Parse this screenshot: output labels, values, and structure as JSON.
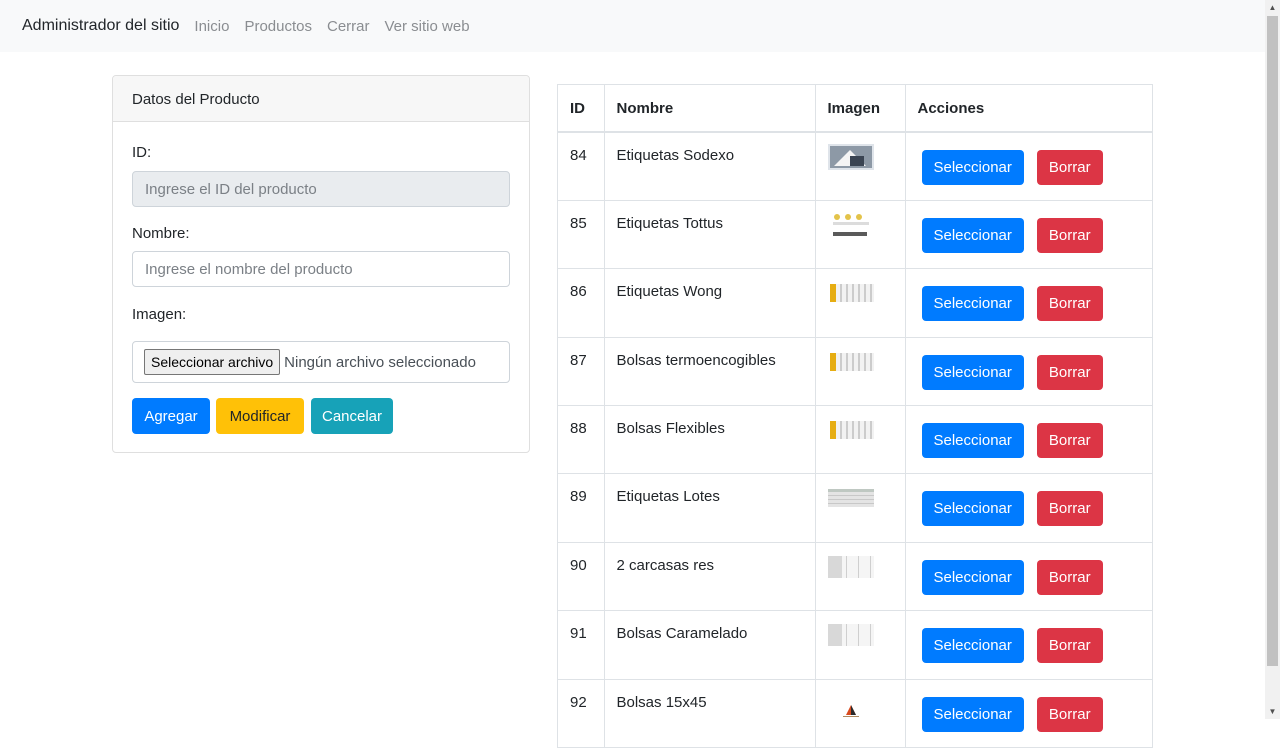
{
  "navbar": {
    "brand": "Administrador del sitio",
    "links": [
      "Inicio",
      "Productos",
      "Cerrar",
      "Ver sitio web"
    ]
  },
  "form": {
    "header": "Datos del Producto",
    "id_label": "ID:",
    "id_placeholder": "Ingrese el ID del producto",
    "name_label": "Nombre:",
    "name_placeholder": "Ingrese el nombre del producto",
    "image_label": "Imagen:",
    "file_button": "Seleccionar archivo",
    "file_status": "Ningún archivo seleccionado",
    "buttons": {
      "add": "Agregar",
      "modify": "Modificar",
      "cancel": "Cancelar"
    }
  },
  "table": {
    "headers": [
      "ID",
      "Nombre",
      "Imagen",
      "Acciones"
    ],
    "select_label": "Seleccionar",
    "delete_label": "Borrar",
    "rows": [
      {
        "id": "84",
        "name": "Etiquetas Sodexo",
        "thumb": "photo-thumb"
      },
      {
        "id": "85",
        "name": "Etiquetas Tottus",
        "thumb": "labels-thumb"
      },
      {
        "id": "86",
        "name": "Etiquetas Wong",
        "thumb": "striped-thumb"
      },
      {
        "id": "87",
        "name": "Bolsas termoencogibles",
        "thumb": "striped-thumb"
      },
      {
        "id": "88",
        "name": "Bolsas Flexibles",
        "thumb": "striped-thumb"
      },
      {
        "id": "89",
        "name": "Etiquetas Lotes",
        "thumb": "sheet-thumb"
      },
      {
        "id": "90",
        "name": "2 carcasas res",
        "thumb": "doc-thumb"
      },
      {
        "id": "91",
        "name": "Bolsas Caramelado",
        "thumb": "doc-thumb"
      },
      {
        "id": "92",
        "name": "Bolsas 15x45",
        "thumb": "logo-thumb"
      }
    ]
  },
  "colors": {
    "primary": "#007bff",
    "warning": "#ffc107",
    "info": "#17a2b8",
    "danger": "#dc3545"
  }
}
